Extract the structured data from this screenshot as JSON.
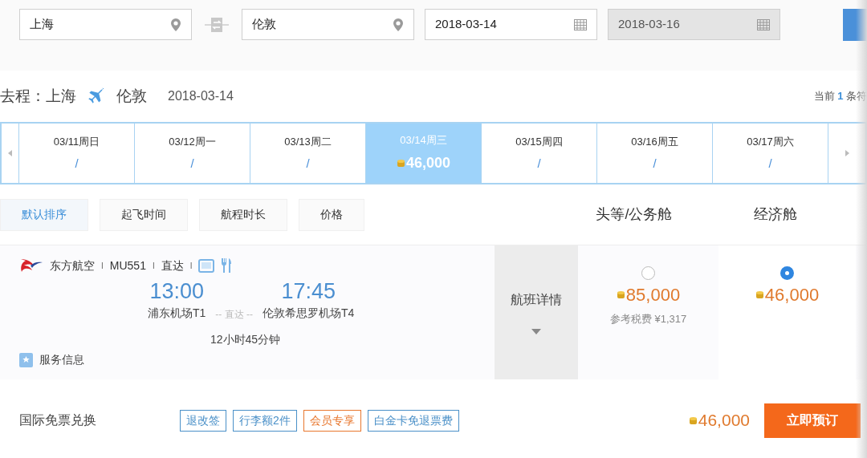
{
  "search": {
    "fields": [
      {
        "kind": "city",
        "value": "上海",
        "disabled": false
      },
      {
        "kind": "city",
        "value": "伦敦",
        "disabled": false
      },
      {
        "kind": "date",
        "value": "2018-03-14",
        "disabled": false
      },
      {
        "kind": "date",
        "value": "2018-03-16",
        "disabled": true
      }
    ]
  },
  "route": {
    "label": "去程：",
    "from": "上海",
    "to": "伦敦",
    "date": "2018-03-14",
    "count_prefix": "当前",
    "count": "1",
    "count_suffix": "条符"
  },
  "dates": [
    {
      "label": "03/11周日",
      "price": "/",
      "selected": false
    },
    {
      "label": "03/12周一",
      "price": "/",
      "selected": false
    },
    {
      "label": "03/13周二",
      "price": "/",
      "selected": false
    },
    {
      "label": "03/14周三",
      "price": "46,000",
      "selected": true
    },
    {
      "label": "03/15周四",
      "price": "/",
      "selected": false
    },
    {
      "label": "03/16周五",
      "price": "/",
      "selected": false
    },
    {
      "label": "03/17周六",
      "price": "/",
      "selected": false
    }
  ],
  "sort_tabs": [
    {
      "label": "默认排序",
      "selected": true
    },
    {
      "label": "起飞时间",
      "selected": false
    },
    {
      "label": "航程时长",
      "selected": false
    },
    {
      "label": "价格",
      "selected": false
    }
  ],
  "cabin_headers": [
    "头等/公务舱",
    "经济舱"
  ],
  "flight": {
    "airline": "东方航空",
    "seps": [
      "I",
      "I",
      "I"
    ],
    "number": "MU551",
    "type": "直达",
    "depart_time": "13:00",
    "arrive_time": "17:45",
    "depart_airport": "浦东机场T1",
    "via": "-- 直达 --",
    "arrive_airport": "伦敦希思罗机场T4",
    "duration": "12小时45分钟",
    "service": "服务信息",
    "details": "航班详情",
    "fares": [
      {
        "price": "85,000",
        "note": "参考税费 ¥1,317",
        "selected": false
      },
      {
        "price": "46,000",
        "selected": true
      }
    ]
  },
  "offer": {
    "title": "国际免票兑换",
    "tags": [
      {
        "label": "退改签",
        "color": "#4a90c8"
      },
      {
        "label": "行李额2件",
        "color": "#4a90c8"
      },
      {
        "label": "会员专享",
        "color": "#e8772e"
      },
      {
        "label": "白金卡免退票费",
        "color": "#4a90c8"
      }
    ],
    "price": "46,000",
    "button": "立即预订"
  }
}
